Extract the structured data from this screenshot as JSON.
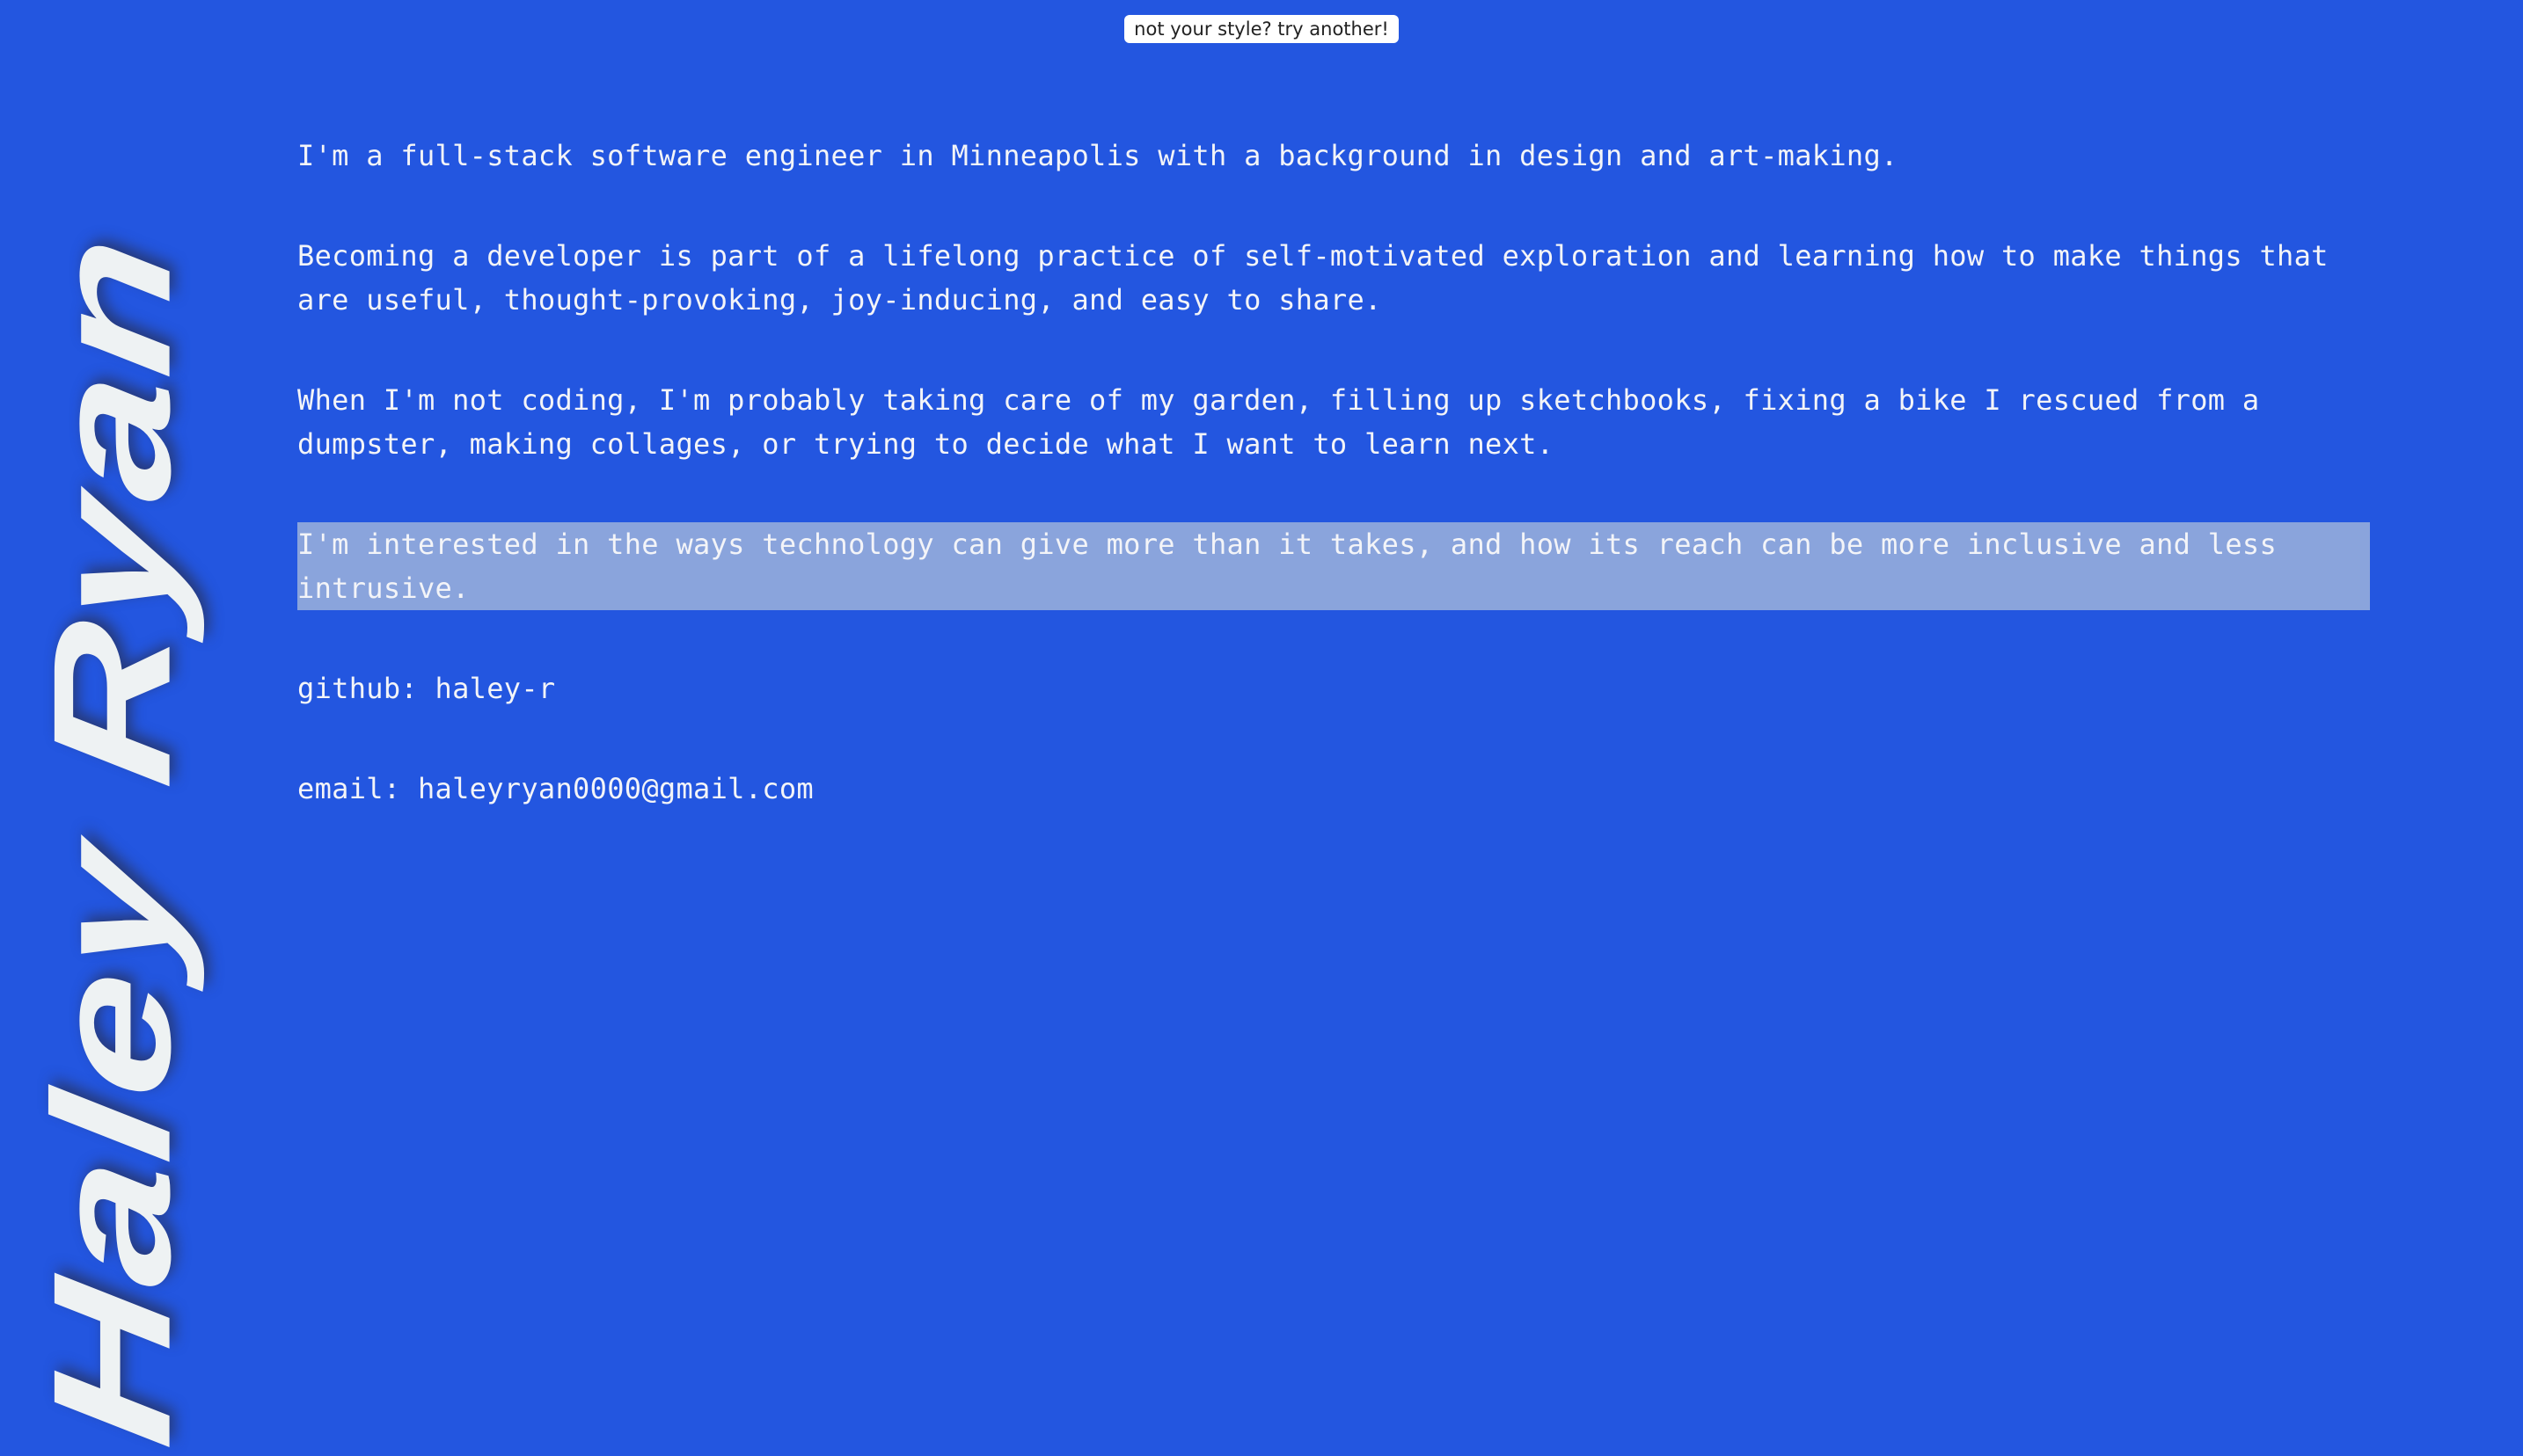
{
  "button": {
    "label": "not your style? try another!"
  },
  "name": "Haley Ryan",
  "paragraphs": [
    "I'm a full-stack software engineer in Minneapolis with a background in design and art-making.",
    "Becoming a developer is part of a lifelong practice of self-motivated exploration and learning how to make things that are useful, thought-provoking, joy-inducing, and easy to share.",
    "When I'm not coding, I'm probably taking care of my garden, filling up sketchbooks, fixing a bike I rescued from a dumpster, making collages, or trying to decide what I want to learn next.",
    "I'm interested in the ways technology can give more than it takes, and how its reach can be more inclusive and less intrusive."
  ],
  "github": {
    "label": "github: ",
    "value": "haley-r"
  },
  "email": {
    "label": "email: ",
    "value": "haleyryan0000@gmail.com"
  },
  "colors": {
    "background": "#2356e0",
    "text": "#f3f4f8",
    "highlight": "#8aa4dc",
    "name": "#eef2f3"
  }
}
